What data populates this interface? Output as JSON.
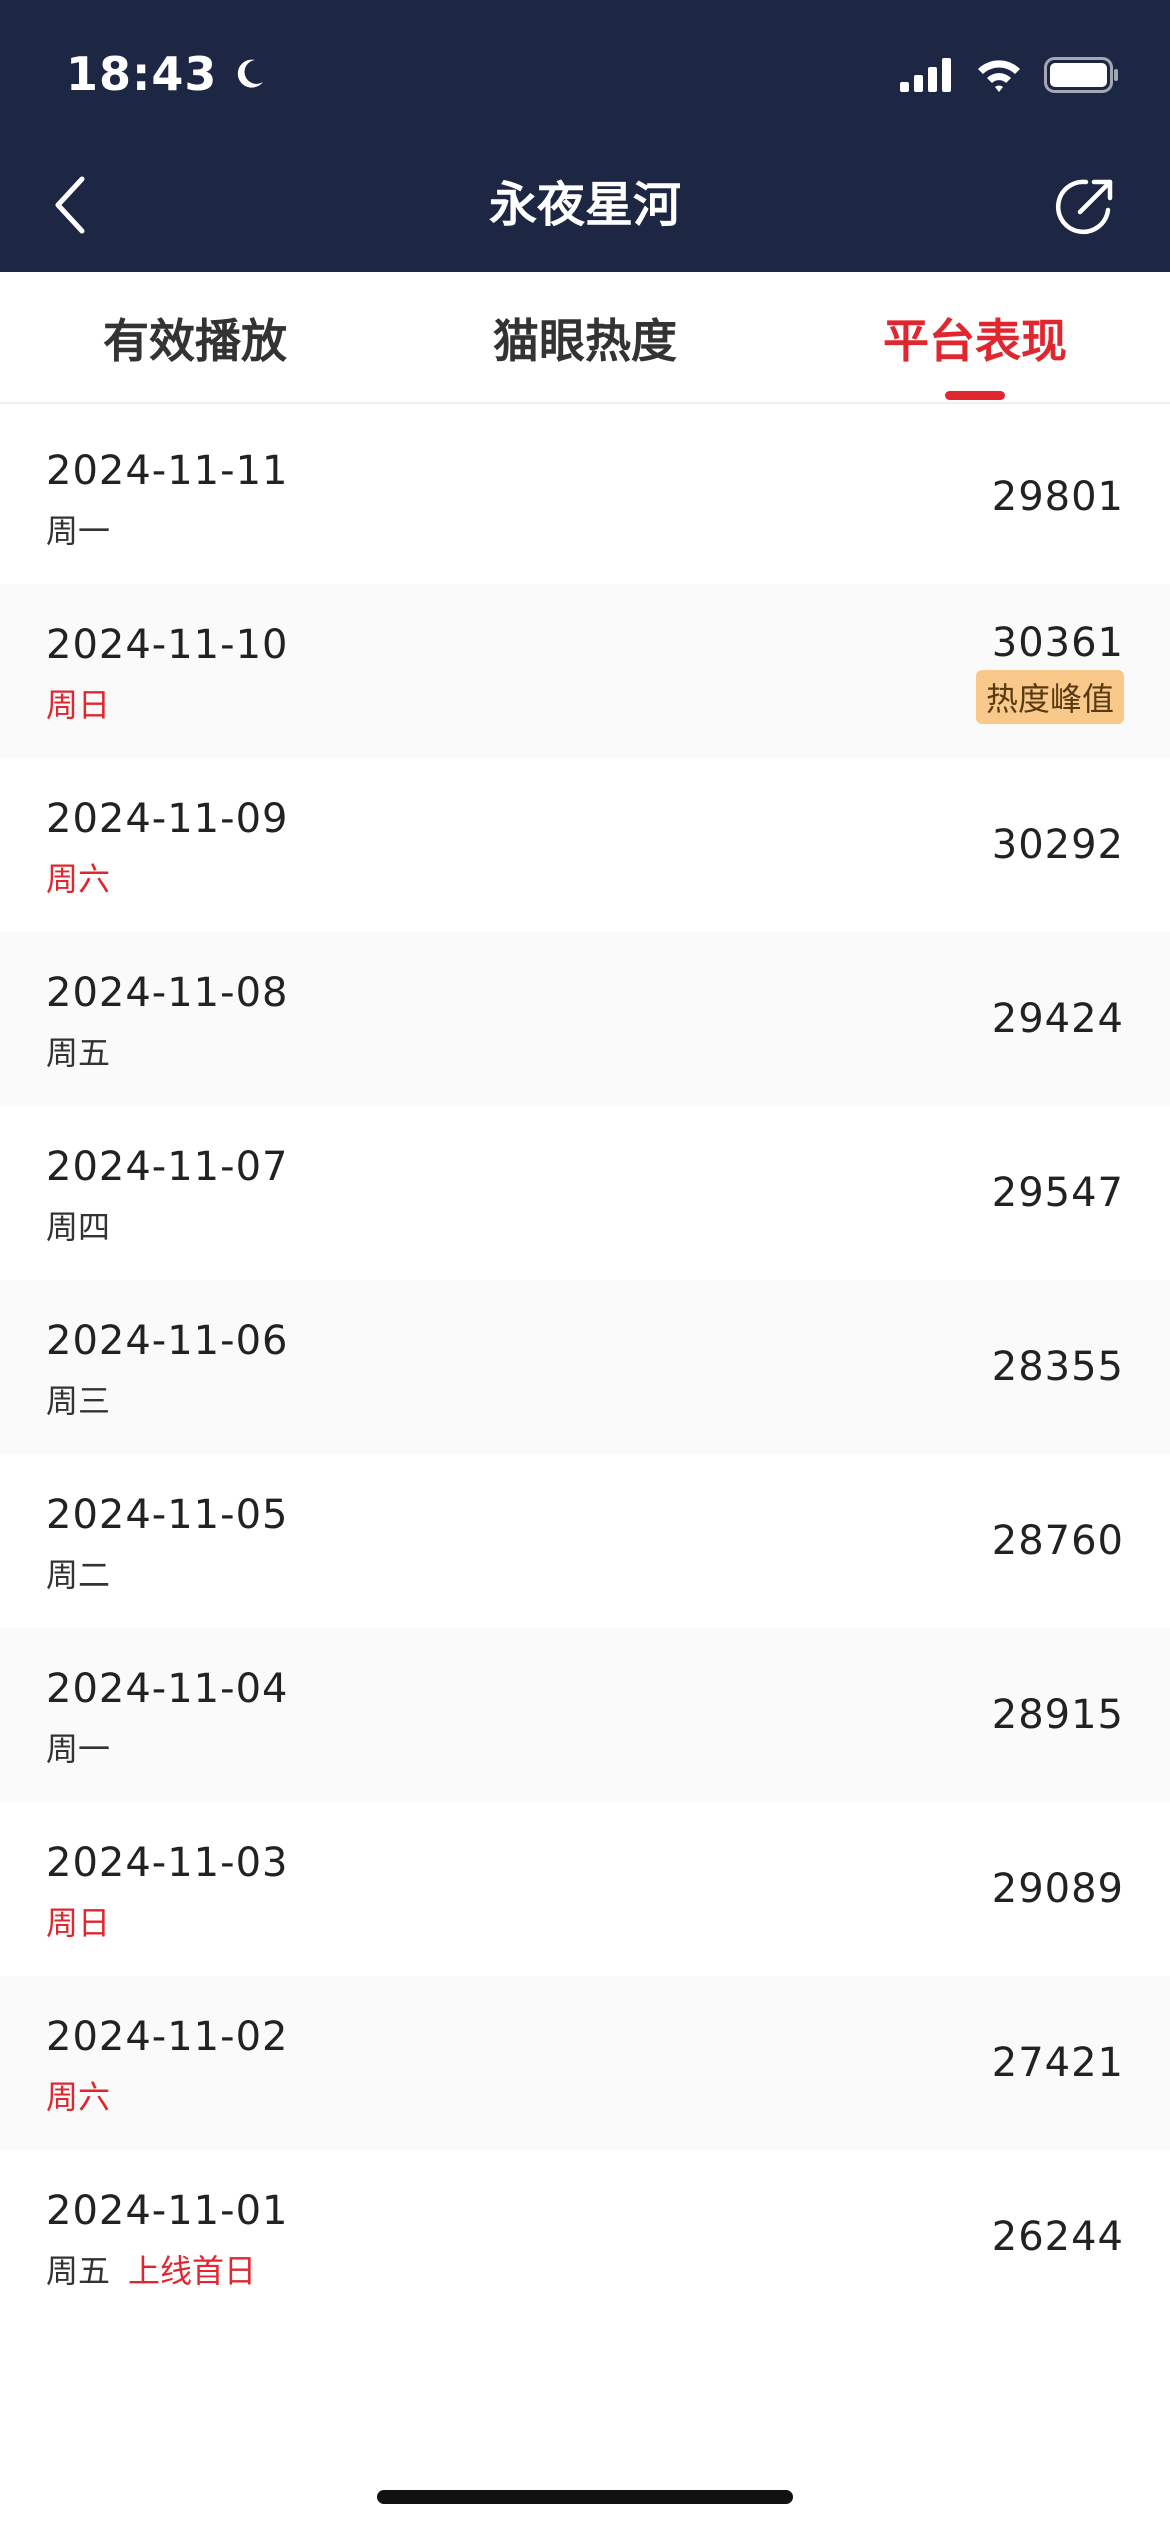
{
  "status_bar": {
    "time": "18:43"
  },
  "nav": {
    "title": "永夜星河"
  },
  "tabs": [
    {
      "label": "有效播放",
      "active": false
    },
    {
      "label": "猫眼热度",
      "active": false
    },
    {
      "label": "平台表现",
      "active": true
    }
  ],
  "rows": [
    {
      "date": "2024-11-11",
      "weekday": "周一",
      "weekend": false,
      "value": "29801"
    },
    {
      "date": "2024-11-10",
      "weekday": "周日",
      "weekend": true,
      "value": "30361",
      "badge": "热度峰值"
    },
    {
      "date": "2024-11-09",
      "weekday": "周六",
      "weekend": true,
      "value": "30292"
    },
    {
      "date": "2024-11-08",
      "weekday": "周五",
      "weekend": false,
      "value": "29424"
    },
    {
      "date": "2024-11-07",
      "weekday": "周四",
      "weekend": false,
      "value": "29547"
    },
    {
      "date": "2024-11-06",
      "weekday": "周三",
      "weekend": false,
      "value": "28355"
    },
    {
      "date": "2024-11-05",
      "weekday": "周二",
      "weekend": false,
      "value": "28760"
    },
    {
      "date": "2024-11-04",
      "weekday": "周一",
      "weekend": false,
      "value": "28915"
    },
    {
      "date": "2024-11-03",
      "weekday": "周日",
      "weekend": true,
      "value": "29089"
    },
    {
      "date": "2024-11-02",
      "weekday": "周六",
      "weekend": true,
      "value": "27421"
    },
    {
      "date": "2024-11-01",
      "weekday": "周五",
      "weekend": false,
      "value": "26244",
      "note": "上线首日"
    }
  ],
  "colors": {
    "header_bg": "#1d2642",
    "accent": "#e0272f",
    "badge_bg": "#f8c98a"
  }
}
